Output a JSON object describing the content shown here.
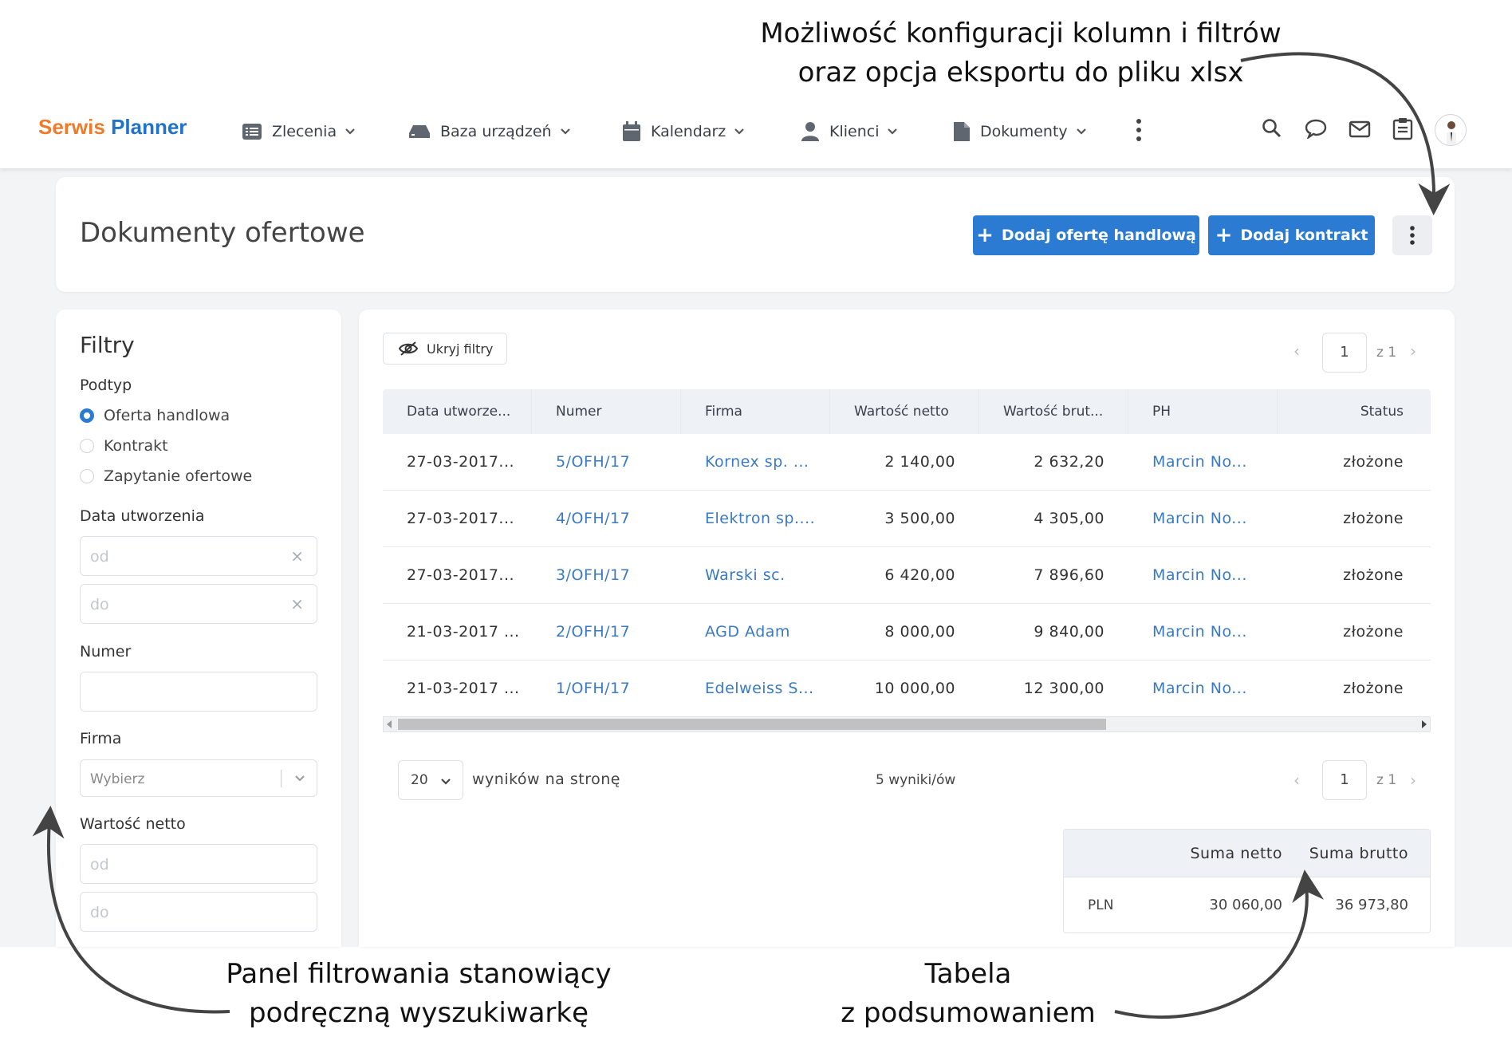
{
  "annotations": {
    "top_line1": "Możliwość konfiguracji kolumn i filtrów",
    "top_line2": "oraz opcja eksportu do pliku xlsx",
    "left_line1": "Panel filtrowania stanowiący",
    "left_line2": "podręczną wyszukiwarkę",
    "right_line1": "Tabela",
    "right_line2": "z podsumowaniem"
  },
  "logo": {
    "part1": "Serwis",
    "part2": "Planner"
  },
  "nav": [
    "Zlecenia",
    "Baza urządzeń",
    "Kalendarz",
    "Klienci",
    "Dokumenty"
  ],
  "page": {
    "title": "Dokumenty ofertowe",
    "btn_offer": "Dodaj ofertę handlową",
    "btn_contract": "Dodaj kontrakt"
  },
  "filters": {
    "title": "Filtry",
    "subtype_label": "Podtyp",
    "subtypes": [
      "Oferta handlowa",
      "Kontrakt",
      "Zapytanie ofertowe"
    ],
    "selected_subtype": "Oferta handlowa",
    "created_label": "Data utworzenia",
    "from_ph": "od",
    "to_ph": "do",
    "number_label": "Numer",
    "company_label": "Firma",
    "company_ph": "Wybierz",
    "net_label": "Wartość netto"
  },
  "toolbar": {
    "hide_filters": "Ukryj filtry",
    "page": "1",
    "of": "z 1"
  },
  "table": {
    "headers": [
      "Data utworze...",
      "Numer",
      "Firma",
      "Wartość netto",
      "Wartość brut...",
      "PH",
      "Status"
    ],
    "rows": [
      [
        "27-03-2017...",
        "5/OFH/17",
        "Kornex sp. ...",
        "2 140,00",
        "2 632,20",
        "Marcin No...",
        "złożone"
      ],
      [
        "27-03-2017...",
        "4/OFH/17",
        "Elektron sp....",
        "3 500,00",
        "4 305,00",
        "Marcin No...",
        "złożone"
      ],
      [
        "27-03-2017...",
        "3/OFH/17",
        "Warski sc.",
        "6 420,00",
        "7 896,60",
        "Marcin No...",
        "złożone"
      ],
      [
        "21-03-2017 ...",
        "2/OFH/17",
        "AGD Adam",
        "8 000,00",
        "9 840,00",
        "Marcin No...",
        "złożone"
      ],
      [
        "21-03-2017 ...",
        "1/OFH/17",
        "Edelweiss S...",
        "10 000,00",
        "12 300,00",
        "Marcin No...",
        "złożone"
      ]
    ]
  },
  "footer": {
    "per_page": "20",
    "per_page_label": "wyników na stronę",
    "results": "5 wyniki/ów",
    "page": "1",
    "of": "z 1"
  },
  "summary": {
    "net_header": "Suma netto",
    "gross_header": "Suma brutto",
    "currency": "PLN",
    "net": "30 060,00",
    "gross": "36 973,80"
  },
  "colors": {
    "accent": "#2b7bd2",
    "logo_orange": "#ee7b2a",
    "logo_blue": "#1f73c9",
    "link": "#3a7ac3"
  }
}
